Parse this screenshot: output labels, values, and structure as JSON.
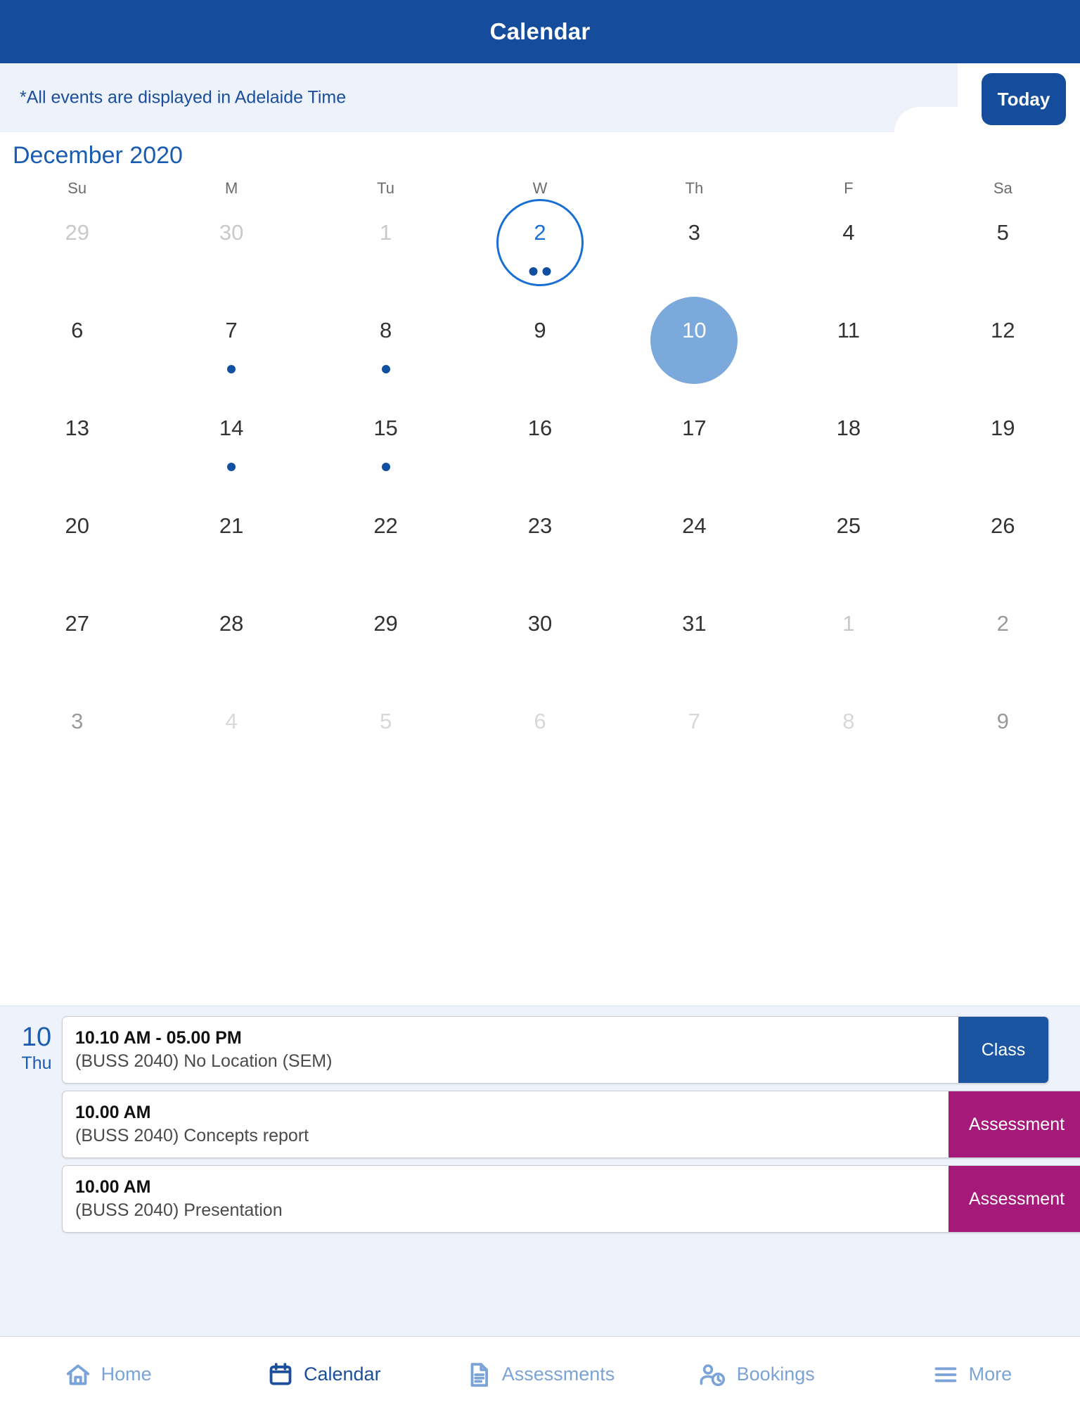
{
  "titlebar": {
    "title": "Calendar"
  },
  "notice": {
    "text": "*All events are displayed in Adelaide Time",
    "today_label": "Today"
  },
  "calendar": {
    "month_title": "December 2020",
    "weekdays": [
      "Su",
      "M",
      "Tu",
      "W",
      "Th",
      "F",
      "Sa"
    ],
    "weeks": [
      [
        {
          "num": "29",
          "state": "muted",
          "dots": 0
        },
        {
          "num": "30",
          "state": "muted",
          "dots": 0
        },
        {
          "num": "1",
          "state": "muted",
          "dots": 0
        },
        {
          "num": "2",
          "state": "ringed",
          "dots": 2
        },
        {
          "num": "3",
          "state": "normal",
          "dots": 0
        },
        {
          "num": "4",
          "state": "normal",
          "dots": 0
        },
        {
          "num": "5",
          "state": "normal",
          "dots": 0
        }
      ],
      [
        {
          "num": "6",
          "state": "normal",
          "dots": 0
        },
        {
          "num": "7",
          "state": "normal",
          "dots": 1
        },
        {
          "num": "8",
          "state": "normal",
          "dots": 1
        },
        {
          "num": "9",
          "state": "normal",
          "dots": 0
        },
        {
          "num": "10",
          "state": "selected",
          "dots": 0
        },
        {
          "num": "11",
          "state": "normal",
          "dots": 0
        },
        {
          "num": "12",
          "state": "normal",
          "dots": 0
        }
      ],
      [
        {
          "num": "13",
          "state": "normal",
          "dots": 0
        },
        {
          "num": "14",
          "state": "normal",
          "dots": 1
        },
        {
          "num": "15",
          "state": "normal",
          "dots": 1
        },
        {
          "num": "16",
          "state": "normal",
          "dots": 0
        },
        {
          "num": "17",
          "state": "normal",
          "dots": 0
        },
        {
          "num": "18",
          "state": "normal",
          "dots": 0
        },
        {
          "num": "19",
          "state": "normal",
          "dots": 0
        }
      ],
      [
        {
          "num": "20",
          "state": "normal",
          "dots": 0
        },
        {
          "num": "21",
          "state": "normal",
          "dots": 0
        },
        {
          "num": "22",
          "state": "normal",
          "dots": 0
        },
        {
          "num": "23",
          "state": "normal",
          "dots": 0
        },
        {
          "num": "24",
          "state": "normal",
          "dots": 0
        },
        {
          "num": "25",
          "state": "normal",
          "dots": 0
        },
        {
          "num": "26",
          "state": "normal",
          "dots": 0
        }
      ],
      [
        {
          "num": "27",
          "state": "normal",
          "dots": 0
        },
        {
          "num": "28",
          "state": "normal",
          "dots": 0
        },
        {
          "num": "29",
          "state": "normal",
          "dots": 0
        },
        {
          "num": "30",
          "state": "normal",
          "dots": 0
        },
        {
          "num": "31",
          "state": "normal",
          "dots": 0
        },
        {
          "num": "1",
          "state": "muted",
          "dots": 0
        },
        {
          "num": "2",
          "state": "semi",
          "dots": 0
        }
      ],
      [
        {
          "num": "3",
          "state": "semi",
          "dots": 0
        },
        {
          "num": "4",
          "state": "dim",
          "dots": 0
        },
        {
          "num": "5",
          "state": "dim",
          "dots": 0
        },
        {
          "num": "6",
          "state": "dim",
          "dots": 0
        },
        {
          "num": "7",
          "state": "dim",
          "dots": 0
        },
        {
          "num": "8",
          "state": "dim",
          "dots": 0
        },
        {
          "num": "9",
          "state": "semi",
          "dots": 0
        }
      ]
    ]
  },
  "events": {
    "day_number": "10",
    "day_of_week": "Thu",
    "items": [
      {
        "time": "10.10 AM - 05.00 PM",
        "description": "(BUSS 2040) No Location (SEM)",
        "badge": "Class",
        "badge_type": "class"
      },
      {
        "time": "10.00 AM",
        "description": "(BUSS 2040) Concepts report",
        "badge": "Assessment",
        "badge_type": "assessment"
      },
      {
        "time": "10.00 AM",
        "description": "(BUSS 2040) Presentation",
        "badge": "Assessment",
        "badge_type": "assessment"
      }
    ]
  },
  "bottom_nav": {
    "items": [
      {
        "label": "Home",
        "icon": "home-icon",
        "active": false
      },
      {
        "label": "Calendar",
        "icon": "calendar-icon",
        "active": true
      },
      {
        "label": "Assessments",
        "icon": "document-icon",
        "active": false
      },
      {
        "label": "Bookings",
        "icon": "person-clock-icon",
        "active": false
      },
      {
        "label": "More",
        "icon": "hamburger-icon",
        "active": false
      }
    ]
  },
  "colors": {
    "header_blue": "#154C9B",
    "notice_bg": "#EDF2FB",
    "accent_blue": "#1A5CAF",
    "selected_day": "#7BA9DC",
    "ring_blue": "#1A6FD4",
    "dot_blue": "#11509E",
    "class_badge": "#1B54A0",
    "assessment_badge": "#A51A79",
    "nav_inactive": "#7BA3D8",
    "nav_active": "#1B4F9C"
  }
}
